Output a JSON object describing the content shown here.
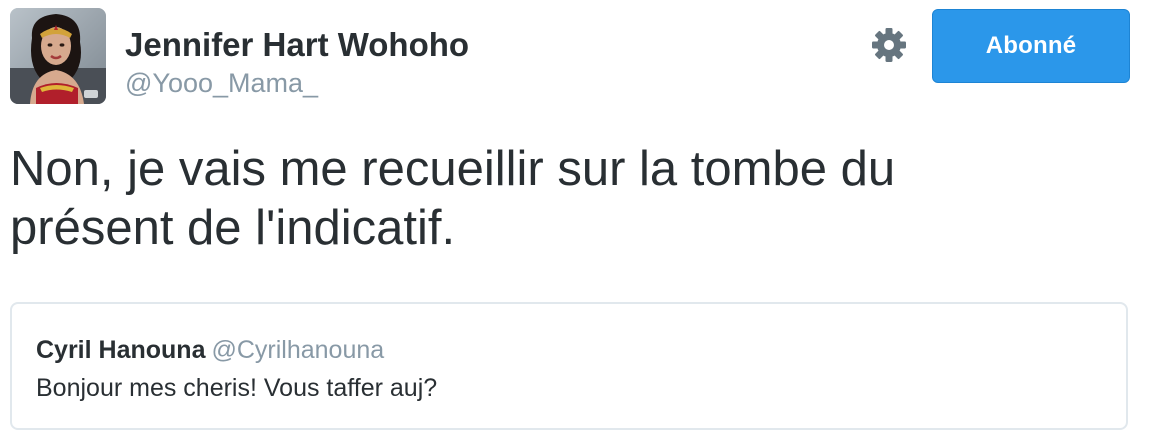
{
  "author": {
    "display_name": "Jennifer Hart Wohoho",
    "screen_name": "@Yooo_Mama_",
    "avatar": "profile-photo"
  },
  "actions": {
    "settings_icon": "gear-icon",
    "follow_label": "Abonné"
  },
  "tweet": {
    "text": "Non, je vais me recueillir sur la tombe du\nprésent de l'indicatif."
  },
  "quoted_tweet": {
    "display_name": "Cyril Hanouna",
    "screen_name": "@Cyrilhanouna",
    "text": "Bonjour mes cheris! Vous taffer auj?"
  },
  "colors": {
    "follow_button": "#2b97ea",
    "text_primary": "#292f33",
    "text_secondary": "#8899a6",
    "gear": "#66757f",
    "quote_border": "#e1e8ed"
  }
}
